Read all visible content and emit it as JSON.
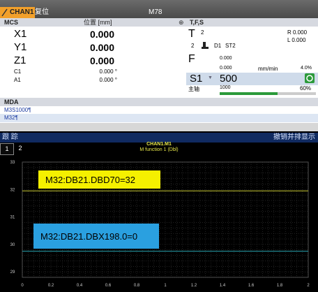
{
  "header": {
    "channel": "CHAN1",
    "reset_label": "复位",
    "program": "M78"
  },
  "mcs": {
    "title": "MCS",
    "column_label": "位置 [mm]",
    "axes": [
      {
        "name": "X1",
        "value": "0.000"
      },
      {
        "name": "Y1",
        "value": "0.000"
      },
      {
        "name": "Z1",
        "value": "0.000"
      }
    ],
    "small_axes": [
      {
        "name": "C1",
        "value": "0.000 °"
      },
      {
        "name": "A1",
        "value": "0.000 °"
      }
    ]
  },
  "tfs": {
    "title": "T,F,S",
    "t_label": "T",
    "t_value": "2",
    "r_value": "R 0.000",
    "l_value": "L 0.000",
    "d_row": {
      "num": "2",
      "d": "D1",
      "st": "ST2"
    },
    "f_label": "F",
    "f_value1": "0.000",
    "f_value2": "0.000",
    "f_unit": "mm/min",
    "f_percent": "4.0%",
    "s_label": "S1",
    "s_value": "500",
    "spindle_label": "主轴",
    "spindle_actual": "1000",
    "spindle_percent": "60%"
  },
  "mda": {
    "title": "MDA",
    "lines": [
      "M3S1000¶",
      "M32¶"
    ]
  },
  "trace": {
    "title": "跟 踪",
    "right_label": "撤销并排显示",
    "tabs": [
      "1",
      "2"
    ],
    "chart_title1": "CHAN1.M1",
    "chart_title2": "M function 1 (Dbl)"
  },
  "chart_data": {
    "type": "line",
    "ylim": [
      28.8,
      33
    ],
    "xlim": [
      0,
      2
    ],
    "yticks": [
      "33",
      "32",
      "31",
      "30",
      "29"
    ],
    "xticks": [
      "0",
      "0.2",
      "0.4",
      "0.6",
      "0.8",
      "1",
      "1.2",
      "1.4",
      "1.6",
      "1.8",
      "2"
    ],
    "series": [
      {
        "x": [
          0,
          2
        ],
        "y": [
          31.95,
          31.95
        ],
        "color": "#c8c832",
        "label": "M32:DB21.DBD70=32",
        "label_bg": "#f5f000"
      },
      {
        "x": [
          0,
          2
        ],
        "y": [
          29.75,
          29.75
        ],
        "color": "#2aa5b0",
        "label": "M32:DB21.DBX198.0=0",
        "label_bg": "#2aa0e0"
      }
    ],
    "grid": true
  }
}
